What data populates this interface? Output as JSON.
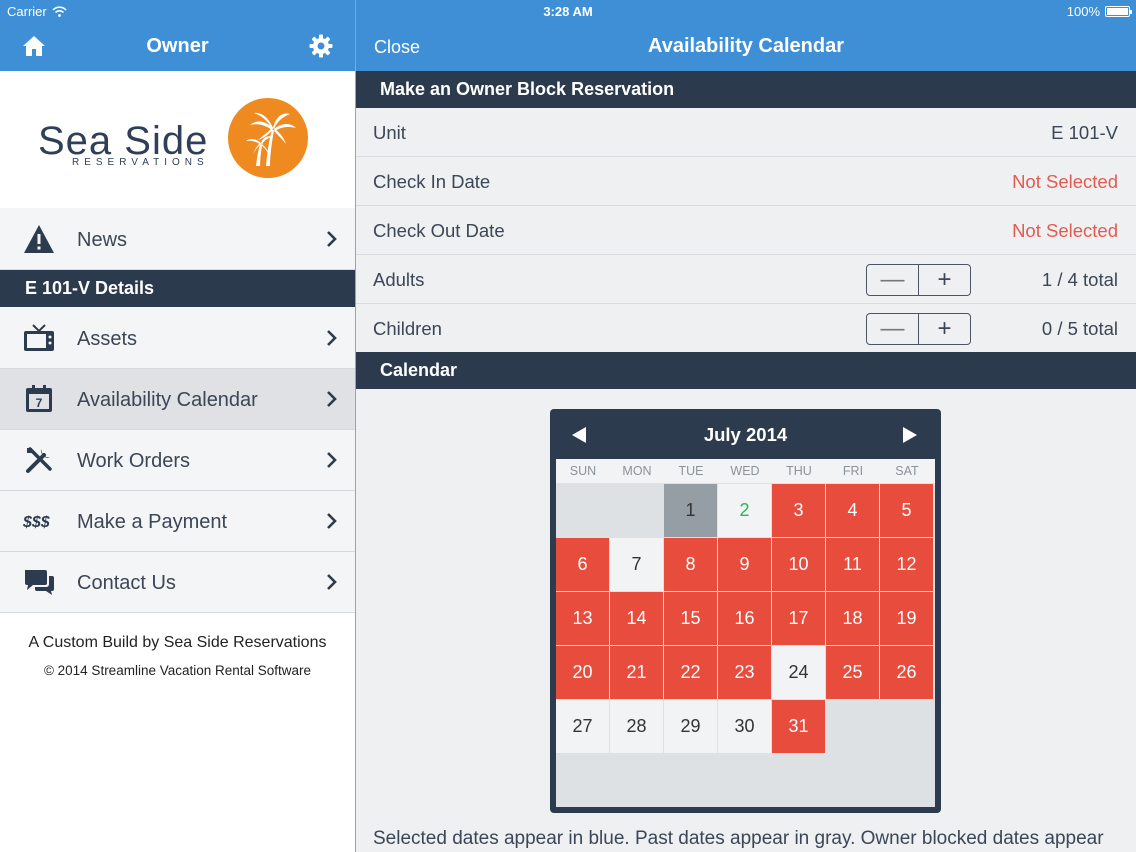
{
  "status_bar": {
    "carrier": "Carrier",
    "time": "3:28 AM",
    "battery": "100%"
  },
  "left": {
    "header_title": "Owner",
    "logo_word": "Sea Side",
    "logo_sub": "RESERVATIONS",
    "news_label": "News",
    "section_title": "E 101-V Details",
    "items": [
      {
        "label": "Assets",
        "icon": "tv-icon"
      },
      {
        "label": "Availability Calendar",
        "icon": "calendar-icon"
      },
      {
        "label": "Work Orders",
        "icon": "tools-icon"
      },
      {
        "label": "Make a Payment",
        "icon": "dollar-icon"
      },
      {
        "label": "Contact Us",
        "icon": "chat-icon"
      }
    ],
    "footer_line1": "A Custom Build by Sea Side Reservations",
    "footer_line2": "© 2014 Streamline Vacation Rental Software"
  },
  "right": {
    "close_label": "Close",
    "header_title": "Availability Calendar",
    "section_title": "Make an Owner Block Reservation",
    "rows": {
      "unit": {
        "label": "Unit",
        "value": "E 101-V"
      },
      "check_in": {
        "label": "Check In Date",
        "value": "Not Selected"
      },
      "check_out": {
        "label": "Check Out Date",
        "value": "Not Selected"
      },
      "adults": {
        "label": "Adults",
        "value": "1 / 4 total"
      },
      "children": {
        "label": "Children",
        "value": "0 / 5 total"
      }
    },
    "stepper": {
      "minus": "—",
      "plus": "+"
    },
    "calendar_section": "Calendar",
    "calendar": {
      "month": "July 2014",
      "days_of_week": [
        "SUN",
        "MON",
        "TUE",
        "WED",
        "THU",
        "FRI",
        "SAT"
      ],
      "first_weekday": 2,
      "days": [
        {
          "d": "1",
          "s": "past"
        },
        {
          "d": "2",
          "s": "green"
        },
        {
          "d": "3",
          "s": "red"
        },
        {
          "d": "4",
          "s": "red"
        },
        {
          "d": "5",
          "s": "red"
        },
        {
          "d": "6",
          "s": "red"
        },
        {
          "d": "7",
          "s": "white"
        },
        {
          "d": "8",
          "s": "red"
        },
        {
          "d": "9",
          "s": "red"
        },
        {
          "d": "10",
          "s": "red"
        },
        {
          "d": "11",
          "s": "red"
        },
        {
          "d": "12",
          "s": "red"
        },
        {
          "d": "13",
          "s": "red"
        },
        {
          "d": "14",
          "s": "red"
        },
        {
          "d": "15",
          "s": "red"
        },
        {
          "d": "16",
          "s": "red"
        },
        {
          "d": "17",
          "s": "red"
        },
        {
          "d": "18",
          "s": "red"
        },
        {
          "d": "19",
          "s": "red"
        },
        {
          "d": "20",
          "s": "red"
        },
        {
          "d": "21",
          "s": "red"
        },
        {
          "d": "22",
          "s": "red"
        },
        {
          "d": "23",
          "s": "red"
        },
        {
          "d": "24",
          "s": "white"
        },
        {
          "d": "25",
          "s": "red"
        },
        {
          "d": "26",
          "s": "red"
        },
        {
          "d": "27",
          "s": "white"
        },
        {
          "d": "28",
          "s": "white"
        },
        {
          "d": "29",
          "s": "white"
        },
        {
          "d": "30",
          "s": "white"
        },
        {
          "d": "31",
          "s": "red"
        }
      ]
    },
    "note": "Selected dates appear in blue. Past dates appear in gray. Owner blocked dates appear"
  },
  "colors": {
    "header_blue": "#3e8fd6",
    "dark_navy": "#2b3a4c",
    "booked_red": "#e74c3c",
    "not_selected_red": "#e35b50",
    "logo_orange": "#ee8a20"
  }
}
